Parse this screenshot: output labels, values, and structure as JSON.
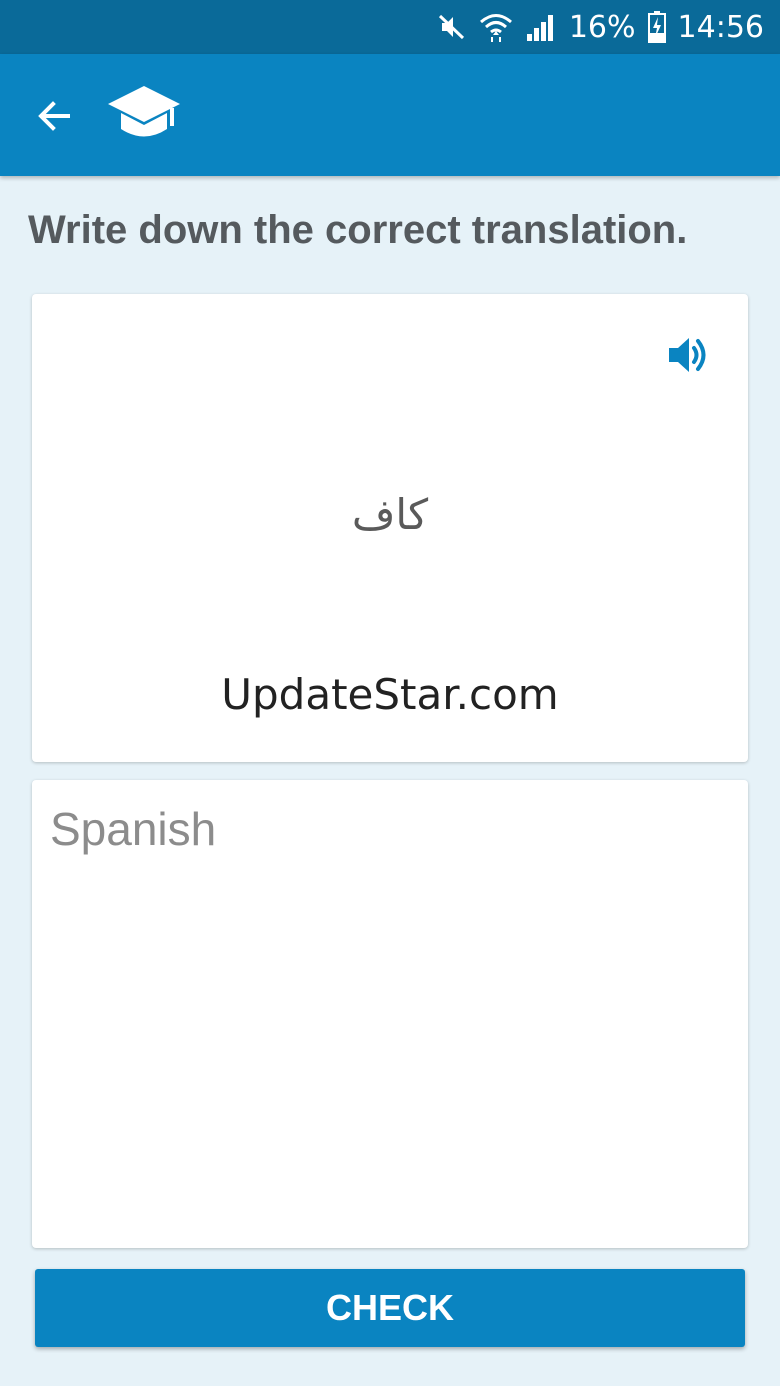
{
  "status_bar": {
    "battery": "16%",
    "time": "14:56",
    "icons": [
      "mute-icon",
      "wifi-icon",
      "signal-icon",
      "battery-charging-icon"
    ]
  },
  "app_bar": {
    "back_icon": "back-arrow-icon",
    "logo_icon": "graduation-cap-icon"
  },
  "instruction": "Write down the correct translation.",
  "word_card": {
    "word": "كاف",
    "watermark": "UpdateStar.com",
    "audio_icon": "speaker-icon"
  },
  "answer": {
    "value": "",
    "placeholder": "Spanish"
  },
  "check_button": "CHECK",
  "colors": {
    "status_bar": "#0a6a99",
    "app_bar": "#0a84c1",
    "background": "#e6f2f8",
    "accent": "#0a84c1",
    "instruction_text": "#555a5e"
  }
}
